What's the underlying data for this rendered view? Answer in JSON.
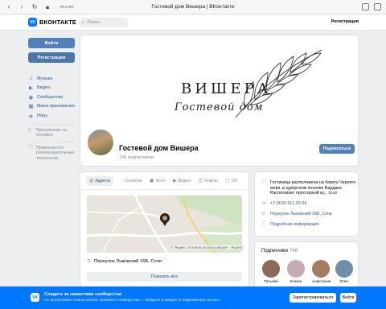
{
  "browser": {
    "url": "vk.com",
    "tab_title": "Гостевой дом Вишера | ВКонтакте"
  },
  "header": {
    "logo_text": "ВКОНТАКТЕ",
    "logo_mark": "VK",
    "search_placeholder": "Поиск",
    "register_link": "Регистрация"
  },
  "sidebar": {
    "login_button": "Войти",
    "register_button": "Регистрация",
    "items": [
      {
        "label": "Музыка",
        "icon": "music-icon"
      },
      {
        "label": "Видео",
        "icon": "video-icon"
      },
      {
        "label": "Сообщества",
        "icon": "communities-icon"
      },
      {
        "label": "Мини-приложения",
        "icon": "apps-icon"
      },
      {
        "label": "Игры",
        "icon": "games-icon"
      }
    ],
    "app_phone": "Приложение на телефон",
    "recommend_tech": "Применяются рекомендательные технологии"
  },
  "cover": {
    "brand_line1": "ВИШЕРА",
    "brand_line2": "Гостевой дом",
    "group_name": "Гостевой дом Вишера",
    "subscribers": "748 подписчиков",
    "subscribe_button": "Подписаться"
  },
  "tabs": [
    {
      "label": "Адреса",
      "active": true
    },
    {
      "label": "Сюжеты",
      "active": false
    },
    {
      "label": "Фото",
      "active": false
    },
    {
      "label": "Видео",
      "active": false
    },
    {
      "label": "Клипы",
      "active": false
    },
    {
      "label": "Об",
      "active": false
    }
  ],
  "map": {
    "attribution": "© Яндекс Условия использования · Яндекс",
    "address": "Переулок Львовский 16Б, Сочи",
    "show_all": "Показать все"
  },
  "info": {
    "description": "Гостиница расположена на берегу Черного моря, в курортном поселке Вардане. Располагает просторной ку...",
    "more": "Ещё",
    "phone": "+7 (918) 911-33-04",
    "address": "Переулок Львовский 16Б, Сочи",
    "details": "Подробная информация"
  },
  "subscribers": {
    "title": "Подписчики",
    "count": "748",
    "people": [
      {
        "name": "Татьяна",
        "color": "#8a6a5a"
      },
      {
        "name": "Елена",
        "color": "#c7a9b6"
      },
      {
        "name": "Анастасия",
        "color": "#a57a5e"
      },
      {
        "name": "Олег",
        "color": "#6f8ea8"
      }
    ]
  },
  "banner": {
    "logo_mark": "VK",
    "title": "Следите за новостями сообщества",
    "text": "Не пропускайте новые записи любимого сообщества — войдите в аккаунт и подпишитесь на него",
    "register_button": "Зарегистрироваться",
    "login_button": "Войти"
  }
}
